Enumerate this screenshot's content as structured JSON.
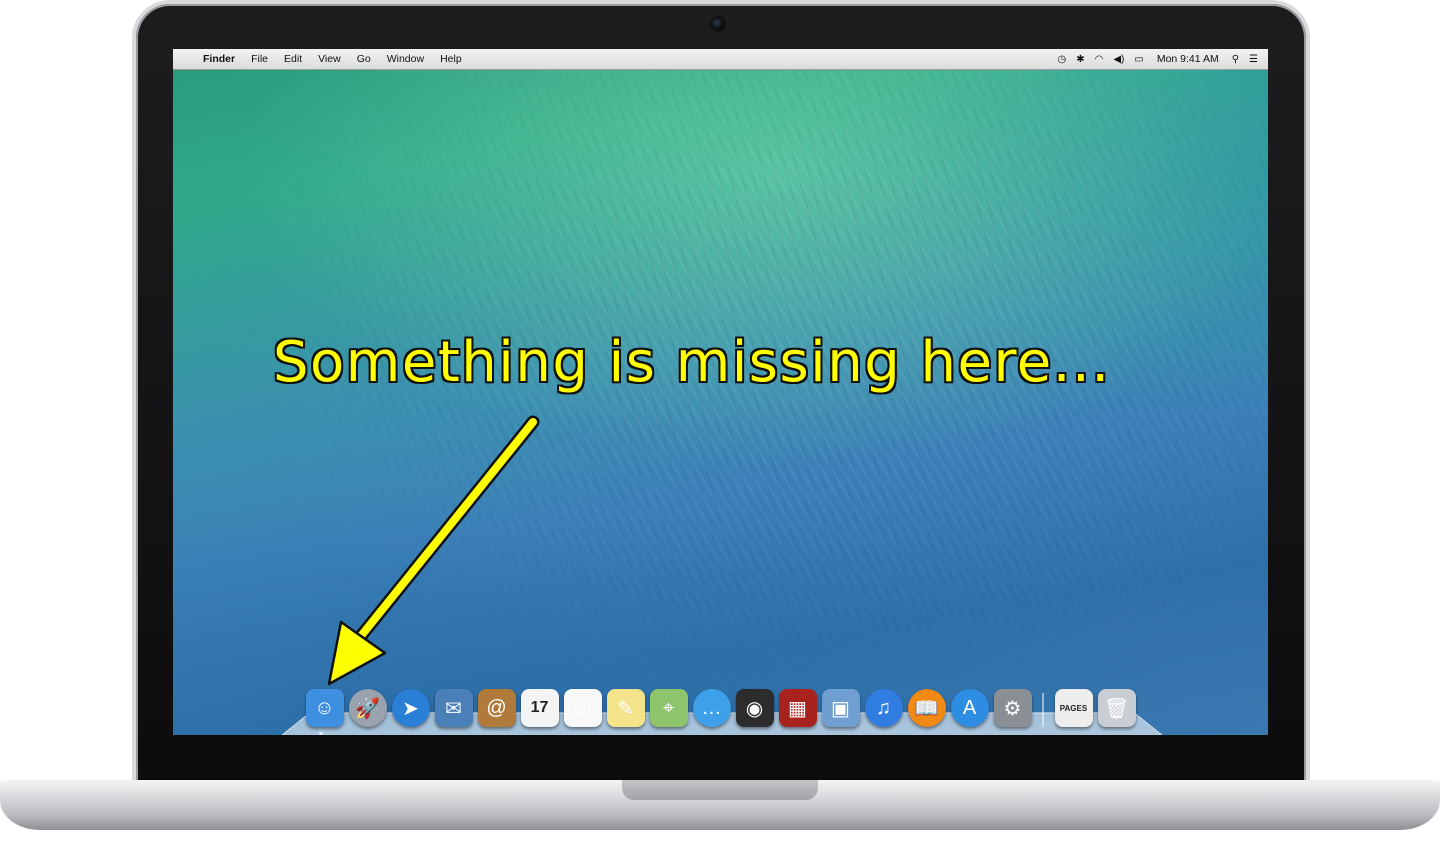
{
  "menubar": {
    "apple_symbol": "",
    "app_name": "Finder",
    "menus": [
      "File",
      "Edit",
      "View",
      "Go",
      "Window",
      "Help"
    ],
    "status_icons": [
      "time-machine-icon",
      "bluetooth-icon",
      "wifi-icon",
      "volume-icon",
      "battery-icon"
    ],
    "clock": "Mon 9:41 AM",
    "spotlight_icon": "search-icon",
    "notification_icon": "list-icon"
  },
  "annotation": {
    "text": "Something is missing here...",
    "color": "#ffff00"
  },
  "dock": {
    "apps": [
      {
        "name": "finder-icon",
        "glyph": "☺",
        "bg": "#3f8fe0"
      },
      {
        "name": "launchpad-icon",
        "glyph": "🚀",
        "bg": "#9aa3ad"
      },
      {
        "name": "safari-icon",
        "glyph": "➤",
        "bg": "#2a7fd6"
      },
      {
        "name": "mail-icon",
        "glyph": "✉",
        "bg": "#4a7fb8"
      },
      {
        "name": "contacts-icon",
        "glyph": "@",
        "bg": "#b07a3a"
      },
      {
        "name": "calendar-icon",
        "glyph": "17",
        "bg": "#f4f4f4"
      },
      {
        "name": "reminders-icon",
        "glyph": "☑",
        "bg": "#f8f8f8"
      },
      {
        "name": "notes-icon",
        "glyph": "✎",
        "bg": "#f3e38a"
      },
      {
        "name": "maps-icon",
        "glyph": "⌖",
        "bg": "#8ec46b"
      },
      {
        "name": "messages-icon",
        "glyph": "…",
        "bg": "#3fa0ea"
      },
      {
        "name": "facetime-icon",
        "glyph": "◉",
        "bg": "#2c2c2c"
      },
      {
        "name": "photo-booth-icon",
        "glyph": "▦",
        "bg": "#a8231d"
      },
      {
        "name": "iphoto-icon",
        "glyph": "▣",
        "bg": "#6f9fd0"
      },
      {
        "name": "itunes-icon",
        "glyph": "♫",
        "bg": "#2f7de0"
      },
      {
        "name": "ibooks-icon",
        "glyph": "📖",
        "bg": "#f08a14"
      },
      {
        "name": "app-store-icon",
        "glyph": "A",
        "bg": "#2d8de3"
      },
      {
        "name": "system-preferences-icon",
        "glyph": "⚙",
        "bg": "#8a8f96"
      }
    ],
    "stack": [
      {
        "name": "pages-document-icon",
        "glyph": "PAGES",
        "bg": "#eeeeee"
      },
      {
        "name": "trash-icon",
        "glyph": "🗑",
        "bg": "#c9ced4"
      }
    ]
  },
  "colors": {
    "bezel": "#111111",
    "menubar": "#e6e6e6",
    "wallpaper_top": "#2fa98a",
    "wallpaper_bottom": "#2f6fa8"
  }
}
